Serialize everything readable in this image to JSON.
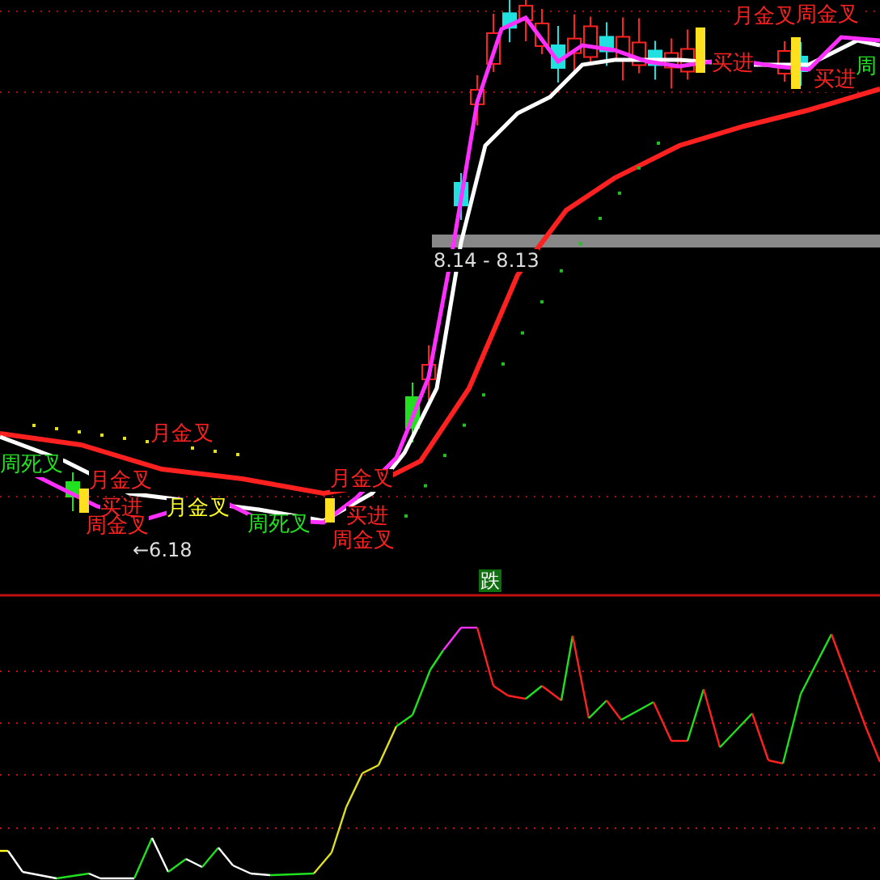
{
  "price_chart": {
    "range_label": "8.14 - 8.13",
    "low_marker": "←6.18",
    "labels": [
      {
        "text": "月金叉",
        "color": "#ff2020"
      },
      {
        "text": "周死叉",
        "color": "#20e020"
      },
      {
        "text": "月金叉",
        "color": "#ff2020"
      },
      {
        "text": "买进",
        "color": "#ff2020"
      },
      {
        "text": "周金叉",
        "color": "#ff2020"
      },
      {
        "text": "月金叉",
        "color": "#ffff20"
      },
      {
        "text": "周死叉",
        "color": "#20e020"
      },
      {
        "text": "月金叉",
        "color": "#ff2020"
      },
      {
        "text": "买进",
        "color": "#ff2020"
      },
      {
        "text": "周金叉",
        "color": "#ff2020"
      },
      {
        "text": "月金叉",
        "color": "#ff2020"
      },
      {
        "text": "周金叉",
        "color": "#ff2020"
      },
      {
        "text": "买进",
        "color": "#ff2020"
      },
      {
        "text": "买进",
        "color": "#ff2020"
      },
      {
        "text": "周",
        "color": "#20e020"
      }
    ]
  },
  "indicator": {
    "signal_badge": "跌"
  }
}
